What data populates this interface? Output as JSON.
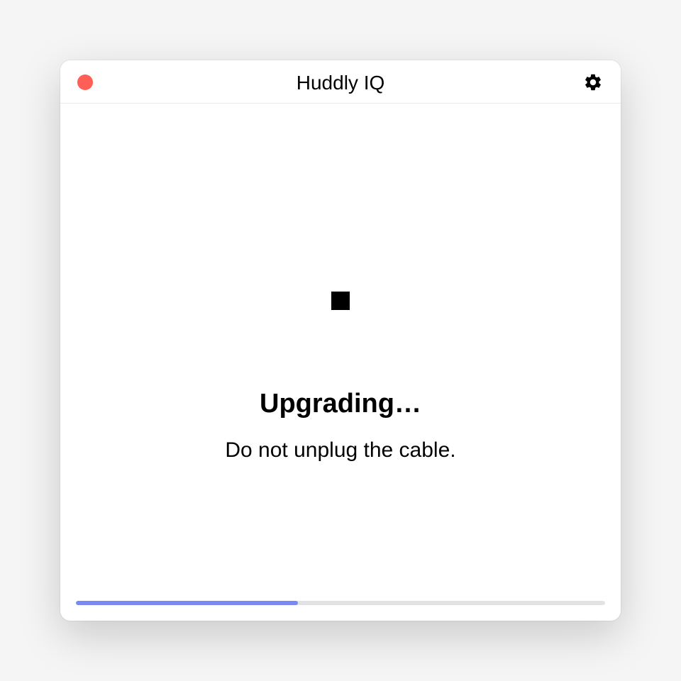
{
  "window": {
    "title": "Huddly IQ"
  },
  "status": {
    "title": "Upgrading…",
    "subtitle": "Do not unplug the cable."
  },
  "progress": {
    "percent": 42
  },
  "colors": {
    "progress_fill": "#7a88f5",
    "close_button": "#ff5f57"
  }
}
